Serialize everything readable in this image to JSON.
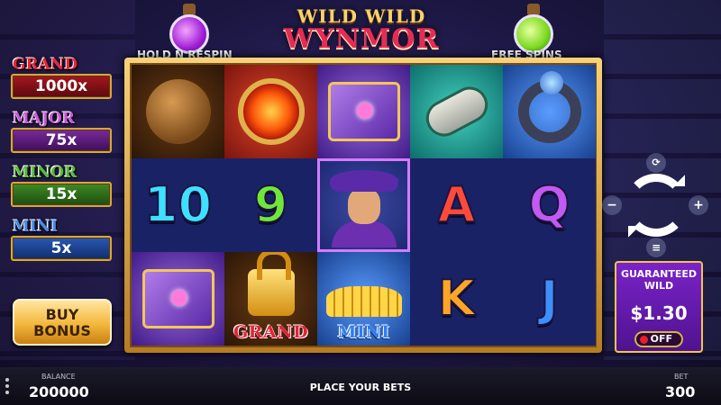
{
  "logo": {
    "line1": "WILD WILD",
    "line2": "WYNMOR"
  },
  "features": {
    "left": "HOLD N RESPIN",
    "right": "FREE SPINS"
  },
  "jackpots": [
    {
      "name": "GRAND",
      "value": "1000x"
    },
    {
      "name": "MAJOR",
      "value": "75x"
    },
    {
      "name": "MINOR",
      "value": "15x"
    },
    {
      "name": "MINI",
      "value": "5x"
    }
  ],
  "buy_bonus": "BUY BONUS",
  "reels": [
    [
      "coin-lock",
      "10",
      "spell-book"
    ],
    [
      "fire-amulet",
      "9",
      "lock-grand"
    ],
    [
      "spell-book",
      "wizard-wild",
      "coins-mini"
    ],
    [
      "scroll",
      "A",
      "K"
    ],
    [
      "magic-ring",
      "Q",
      "J"
    ]
  ],
  "symbols": {
    "ten": "10",
    "nine": "9",
    "a": "A",
    "q": "Q",
    "k": "K",
    "j": "J",
    "grand_tag": "GRAND",
    "mini_tag": "MINI"
  },
  "guaranteed_wild": {
    "title": "GUARANTEED WILD",
    "price": "$1.30",
    "toggle": "OFF"
  },
  "controls": {
    "plus": "+",
    "minus": "−"
  },
  "bottom": {
    "balance_label": "BALANCE",
    "balance": "200000",
    "message": "PLACE YOUR BETS",
    "bet_label": "BET",
    "bet": "300"
  },
  "colors": {
    "frame_gold": "#d9a63a",
    "reel_bg": "#141d5a",
    "wild_highlight": "#d47cff",
    "grand": "#e8243a",
    "major": "#c45ad6",
    "minor": "#58b83a",
    "mini": "#4c86e0"
  }
}
